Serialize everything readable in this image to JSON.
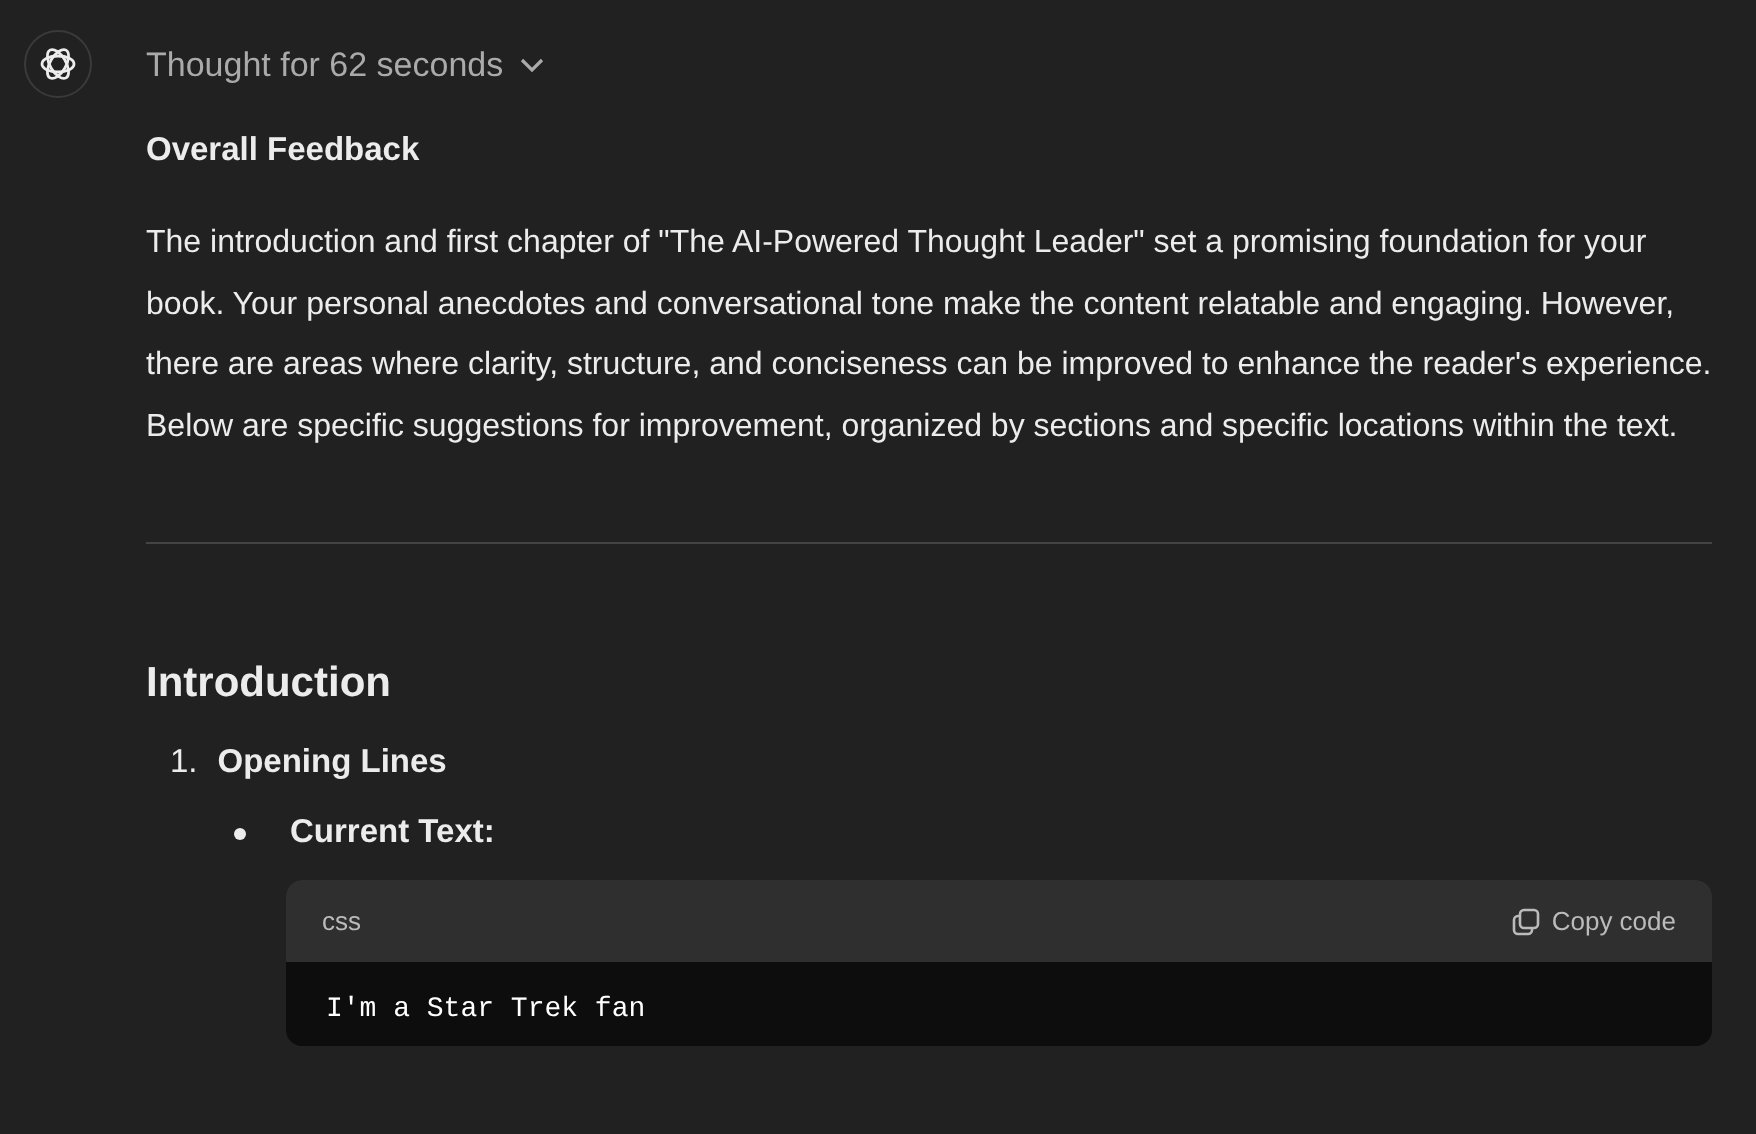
{
  "thought": {
    "label": "Thought for 62 seconds",
    "expanded": false
  },
  "heading": "Overall Feedback",
  "paragraph": "The introduction and first chapter of \"The AI-Powered Thought Leader\" set a promising foundation for your book. Your personal anecdotes and conversational tone make the content relatable and engaging. However, there are areas where clarity, structure, and conciseness can be improved to enhance the reader's experience. Below are specific suggestions for improvement, organized by sections and specific locations within the text.",
  "section": "Introduction",
  "list": [
    {
      "number": "1.",
      "title": "Opening Lines",
      "bullets": [
        {
          "label": "Current Text:",
          "code": {
            "language": "css",
            "copy_label": "Copy code",
            "text": "I'm a Star Trek fan"
          }
        }
      ]
    }
  ]
}
